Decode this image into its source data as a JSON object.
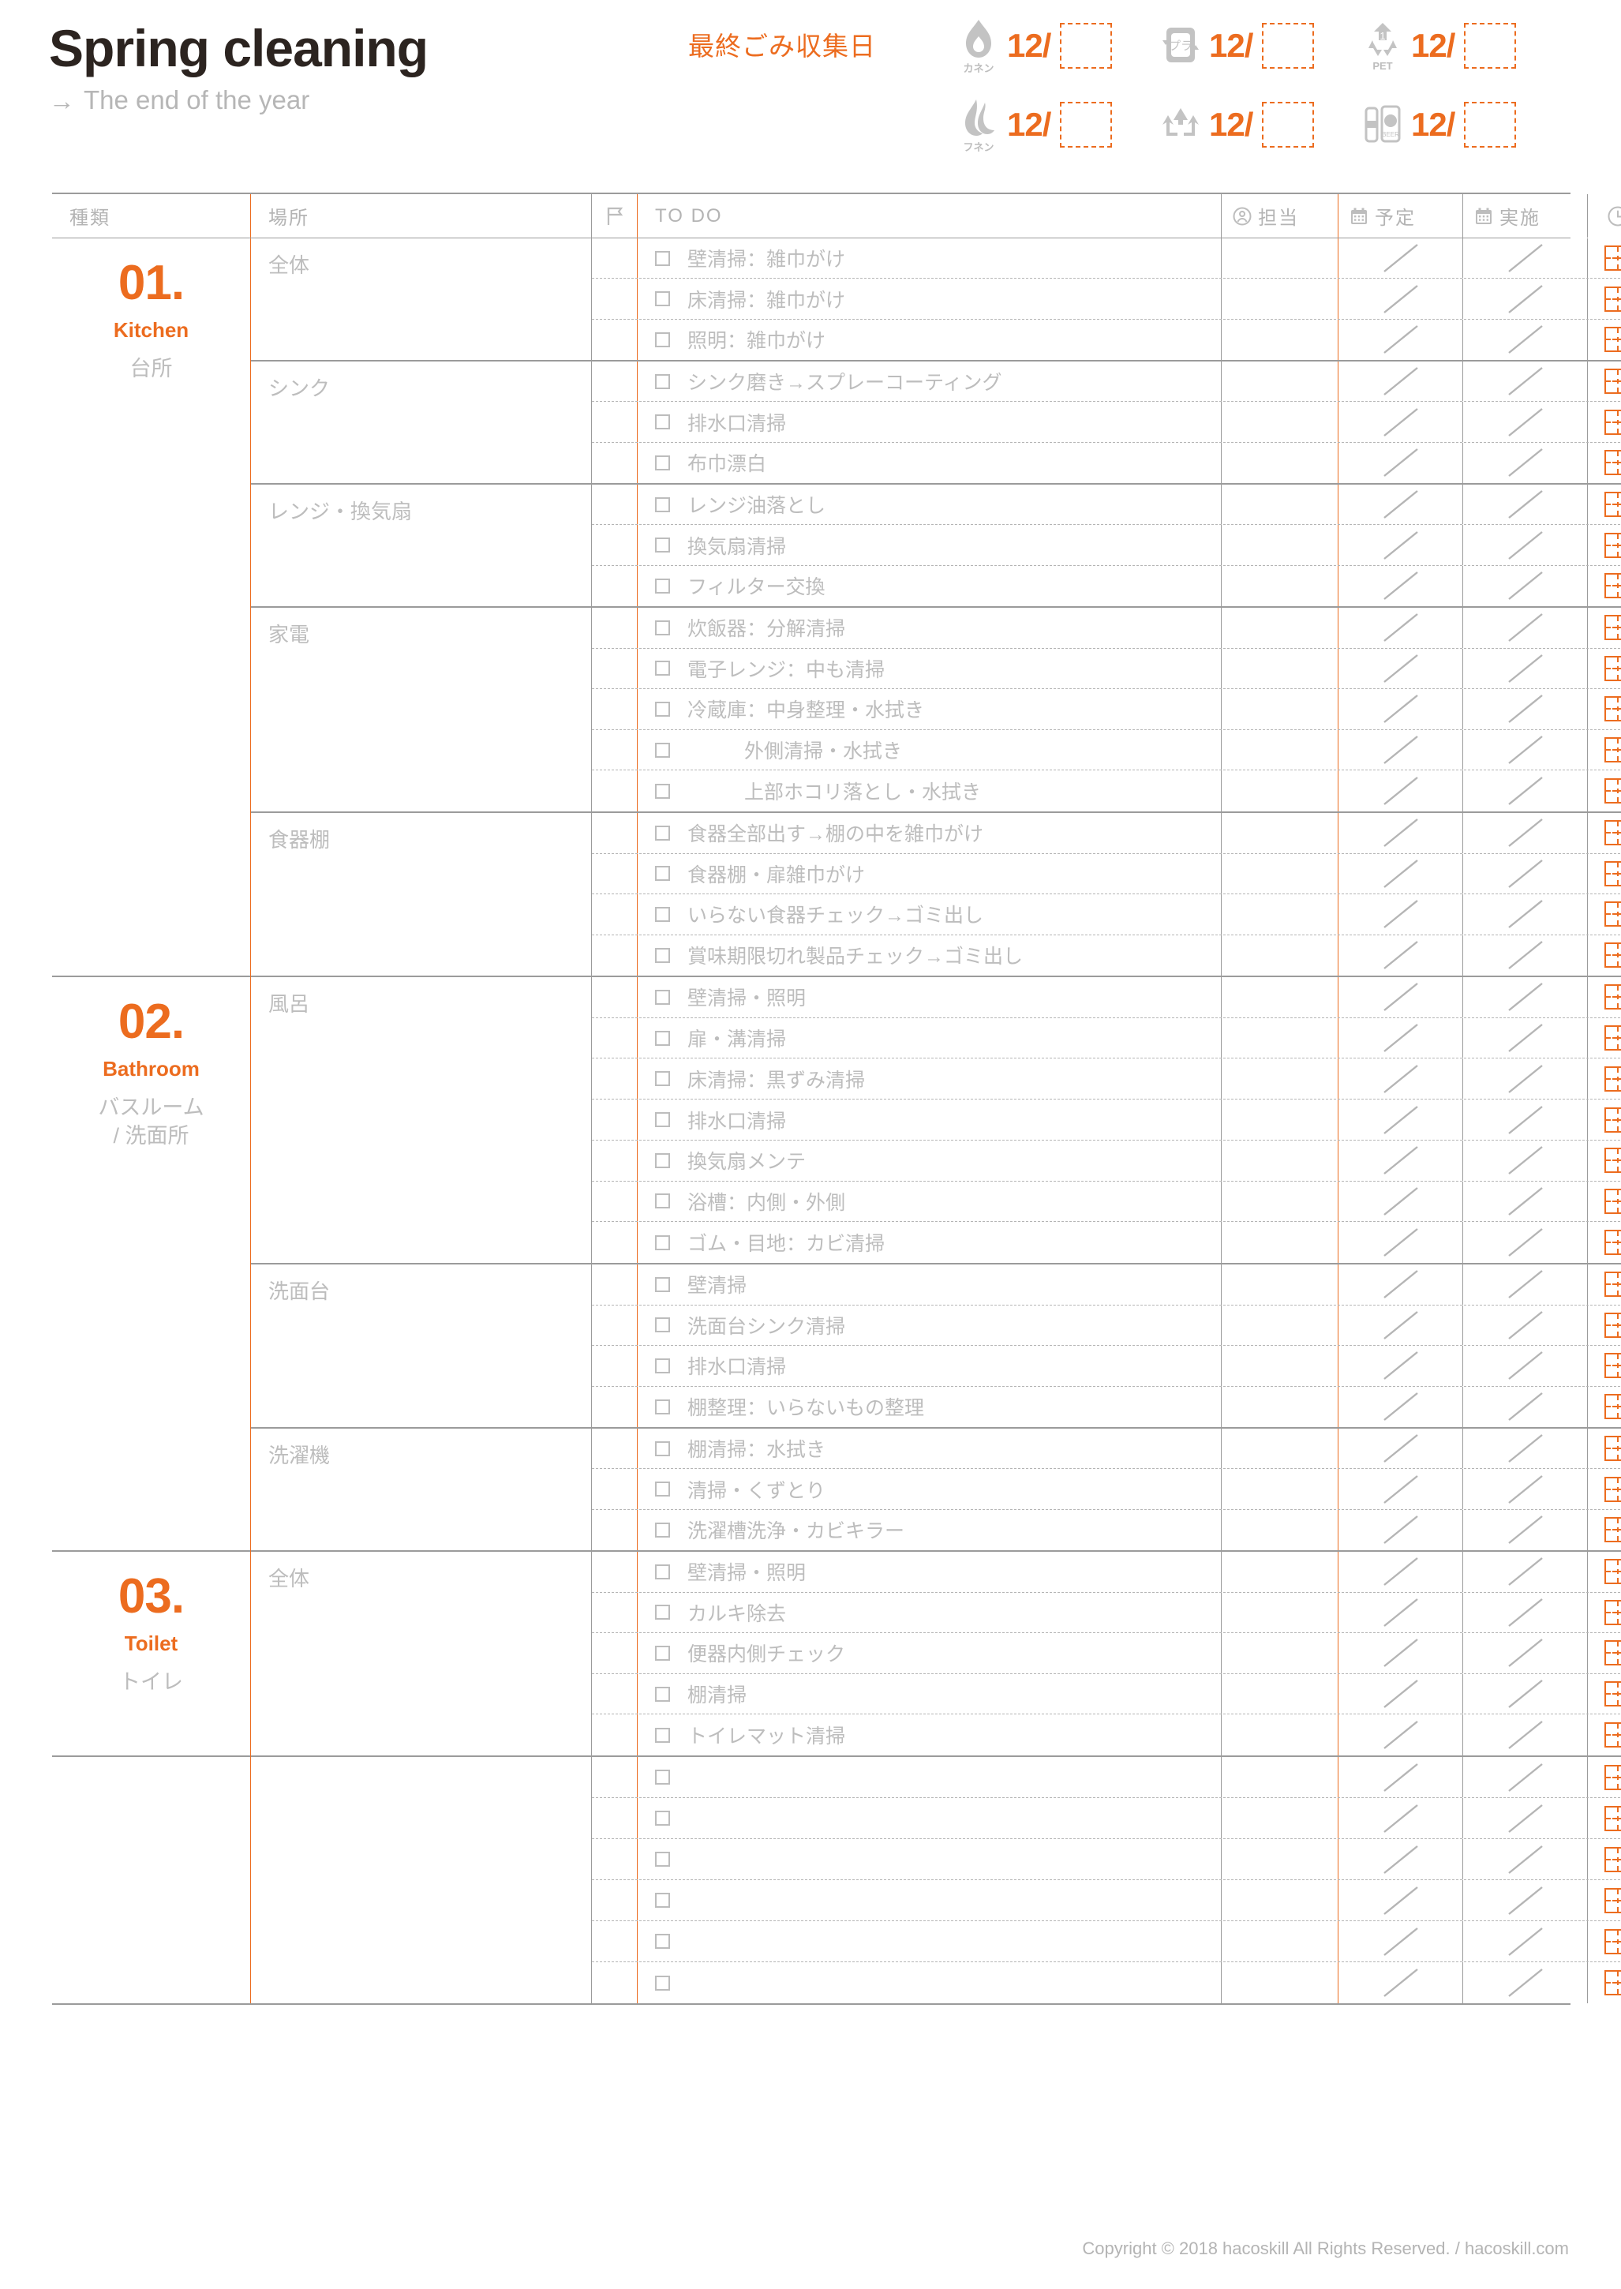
{
  "header": {
    "title": "Spring cleaning",
    "subtitle": "The end of the year",
    "arrow": "→",
    "gomi_label": "最終ごみ収集日",
    "gomi_items": [
      {
        "icon": "flame-icon",
        "caption": "カネン",
        "date": "12/"
      },
      {
        "icon": "plastic-recycle-icon",
        "caption": "",
        "date": "12/"
      },
      {
        "icon": "pet-bottle-icon",
        "caption": "PET",
        "date": "12/"
      },
      {
        "icon": "non-burnable-icon",
        "caption": "フネン",
        "date": "12/"
      },
      {
        "icon": "recycle-arrows-icon",
        "caption": "",
        "date": "12/"
      },
      {
        "icon": "can-bottle-icon",
        "caption": "",
        "date": "12/"
      }
    ]
  },
  "table": {
    "headers": {
      "kind": "種類",
      "place": "場所",
      "flag": "",
      "todo": "TO  DO",
      "who": "担当",
      "plan": "予定",
      "done": "実施",
      "time": ""
    },
    "sections": [
      {
        "number": "01.",
        "en": "Kitchen",
        "jp": "台所",
        "places": [
          {
            "name": "全体",
            "tasks": [
              {
                "text": "壁清掃：雑巾がけ",
                "indent": false
              },
              {
                "text": "床清掃：雑巾がけ",
                "indent": false
              },
              {
                "text": "照明：雑巾がけ",
                "indent": false
              }
            ]
          },
          {
            "name": "シンク",
            "tasks": [
              {
                "text": "シンク磨き→スプレーコーティング",
                "indent": false
              },
              {
                "text": "排水口清掃",
                "indent": false
              },
              {
                "text": "布巾漂白",
                "indent": false
              }
            ]
          },
          {
            "name": "レンジ・換気扇",
            "tasks": [
              {
                "text": "レンジ油落とし",
                "indent": false
              },
              {
                "text": "換気扇清掃",
                "indent": false
              },
              {
                "text": "フィルター交換",
                "indent": false
              }
            ]
          },
          {
            "name": "家電",
            "tasks": [
              {
                "text": "炊飯器：分解清掃",
                "indent": false
              },
              {
                "text": "電子レンジ：中も清掃",
                "indent": false
              },
              {
                "text": "冷蔵庫：中身整理・水拭き",
                "indent": false
              },
              {
                "text": "外側清掃・水拭き",
                "indent": true
              },
              {
                "text": "上部ホコリ落とし・水拭き",
                "indent": true
              }
            ]
          },
          {
            "name": "食器棚",
            "tasks": [
              {
                "text": "食器全部出す→棚の中を雑巾がけ",
                "indent": false
              },
              {
                "text": "食器棚・扉雑巾がけ",
                "indent": false
              },
              {
                "text": "いらない食器チェック→ゴミ出し",
                "indent": false
              },
              {
                "text": "賞味期限切れ製品チェック→ゴミ出し",
                "indent": false
              }
            ]
          }
        ]
      },
      {
        "number": "02.",
        "en": "Bathroom",
        "jp": "バスルーム\n/ 洗面所",
        "places": [
          {
            "name": "風呂",
            "tasks": [
              {
                "text": "壁清掃・照明",
                "indent": false
              },
              {
                "text": "扉・溝清掃",
                "indent": false
              },
              {
                "text": "床清掃：黒ずみ清掃",
                "indent": false
              },
              {
                "text": "排水口清掃",
                "indent": false
              },
              {
                "text": "換気扇メンテ",
                "indent": false
              },
              {
                "text": "浴槽：内側・外側",
                "indent": false
              },
              {
                "text": "ゴム・目地：カビ清掃",
                "indent": false
              }
            ]
          },
          {
            "name": "洗面台",
            "tasks": [
              {
                "text": "壁清掃",
                "indent": false
              },
              {
                "text": "洗面台シンク清掃",
                "indent": false
              },
              {
                "text": "排水口清掃",
                "indent": false
              },
              {
                "text": "棚整理：いらないもの整理",
                "indent": false
              }
            ]
          },
          {
            "name": "洗濯機",
            "tasks": [
              {
                "text": "棚清掃：水拭き",
                "indent": false
              },
              {
                "text": "清掃・くずとり",
                "indent": false
              },
              {
                "text": "洗濯槽洗浄・カビキラー",
                "indent": false
              }
            ]
          }
        ]
      },
      {
        "number": "03.",
        "en": "Toilet",
        "jp": "トイレ",
        "places": [
          {
            "name": "全体",
            "tasks": [
              {
                "text": "壁清掃・照明",
                "indent": false
              },
              {
                "text": "カルキ除去",
                "indent": false
              },
              {
                "text": "便器内側チェック",
                "indent": false
              },
              {
                "text": "棚清掃",
                "indent": false
              },
              {
                "text": "トイレマット清掃",
                "indent": false
              }
            ]
          }
        ]
      },
      {
        "number": "",
        "en": "",
        "jp": "",
        "places": [
          {
            "name": "",
            "tasks": [
              {
                "text": "",
                "indent": false
              },
              {
                "text": "",
                "indent": false
              },
              {
                "text": "",
                "indent": false
              },
              {
                "text": "",
                "indent": false
              },
              {
                "text": "",
                "indent": false
              },
              {
                "text": "",
                "indent": false
              }
            ]
          }
        ]
      }
    ]
  },
  "footer": {
    "copyright": "Copyright © 2018 hacoskill All Rights Reserved.  / hacoskill.com"
  },
  "colors": {
    "accent": "#ec6c1f",
    "text_gray": "#bdbdbd",
    "line_gray": "#9b9b9b",
    "title_dark": "#2c2420"
  }
}
